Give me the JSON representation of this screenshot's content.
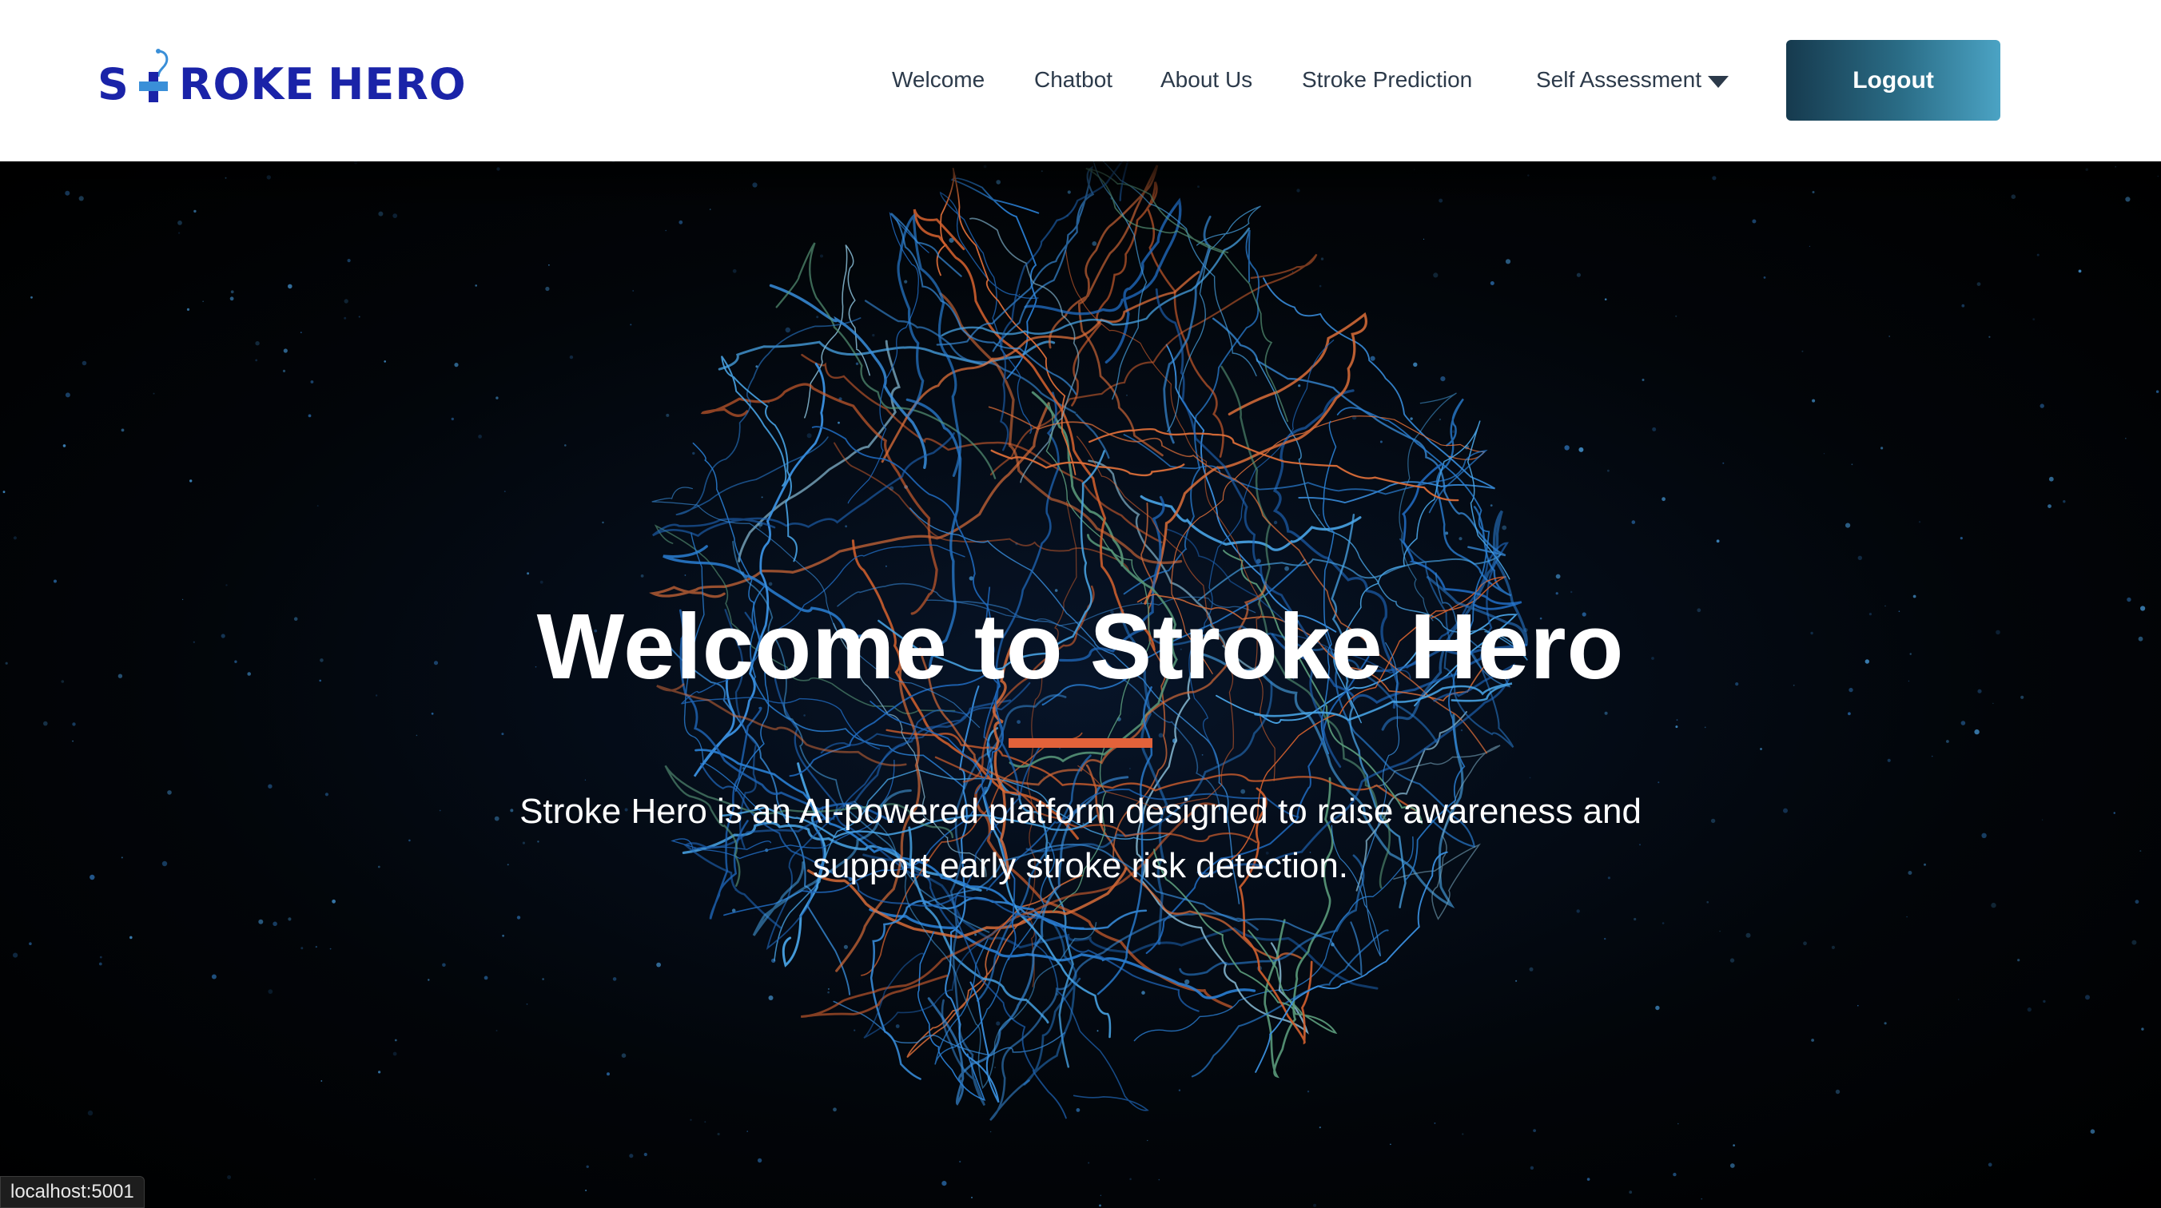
{
  "logo": {
    "letter_s": "S",
    "rest": "ROKE",
    "word2": "HERO",
    "icon": "medical-cross-stethoscope-icon",
    "color": "#1a23a8"
  },
  "nav": {
    "welcome": "Welcome",
    "chatbot": "Chatbot",
    "about": "About Us",
    "prediction": "Stroke Prediction",
    "self_assessment": "Self Assessment",
    "self_assessment_icon": "caret-down-icon"
  },
  "logout_label": "Logout",
  "hero": {
    "title": "Welcome to Stroke Hero",
    "subtitle": "Stroke Hero is an AI-powered platform designed to raise awareness and support early stroke risk detection.",
    "accent_color": "#e2623a"
  },
  "status_url": "localhost:5001"
}
